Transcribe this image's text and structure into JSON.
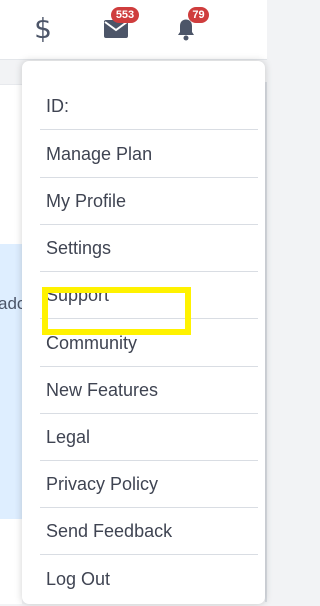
{
  "header": {
    "icons": {
      "dollar": "$",
      "mail": "mail-icon",
      "bell": "bell-icon"
    },
    "mail_count": "553",
    "bell_count": "79"
  },
  "background": {
    "partial_text": "ado"
  },
  "menu": {
    "items": [
      "ID:",
      "Manage Plan",
      "My Profile",
      "Settings",
      "Support",
      "Community",
      "New Features",
      "Legal",
      "Privacy Policy",
      "Send Feedback",
      "Log Out"
    ]
  },
  "colors": {
    "badge": "#cf3d3d",
    "highlight": "#fff200",
    "selected_background": "#deeeff"
  }
}
